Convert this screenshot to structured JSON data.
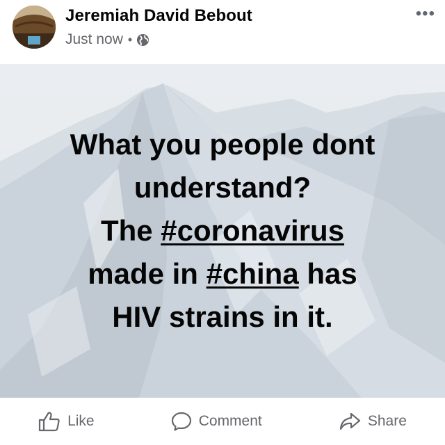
{
  "post": {
    "author_name": "Jeremiah David Bebout",
    "timestamp": "Just now",
    "separator": "•",
    "privacy_icon": "globe-icon",
    "more_icon": "more-dots-icon",
    "more_label": "•••",
    "background": "snowy-mountains",
    "text_lines": [
      {
        "plain_before": "What you people dont",
        "hashtag": "",
        "plain_after": ""
      },
      {
        "plain_before": "understand?",
        "hashtag": "",
        "plain_after": ""
      },
      {
        "plain_before": "The ",
        "hashtag": "#coronavirus",
        "plain_after": ""
      },
      {
        "plain_before": "made in ",
        "hashtag": "#china",
        "plain_after": " has"
      },
      {
        "plain_before": "HIV strains in it.",
        "hashtag": "",
        "plain_after": ""
      }
    ]
  },
  "actions": {
    "like_label": "Like",
    "comment_label": "Comment",
    "share_label": "Share"
  },
  "colors": {
    "name": "#050505",
    "meta": "#65676b",
    "post_text": "#050505",
    "post_background": "#dfe4ea"
  }
}
